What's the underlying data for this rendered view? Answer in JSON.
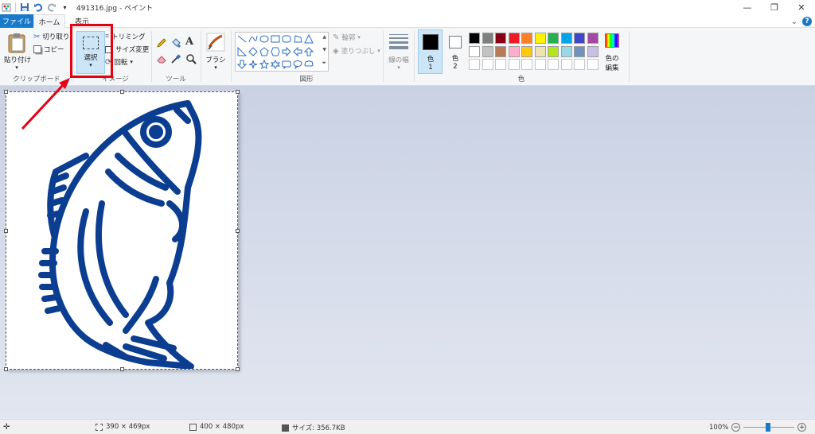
{
  "window": {
    "title": "491316.jpg - ペイント",
    "minimize": "—",
    "restore": "❐",
    "close": "✕"
  },
  "tabs": {
    "file": "ファイル",
    "home": "ホーム",
    "view": "表示"
  },
  "help": {
    "chevron": "⌄",
    "help": "?"
  },
  "clipboard": {
    "paste": "貼り付け",
    "cut": "切り取り",
    "copy": "コピー",
    "label": "クリップボード"
  },
  "image": {
    "select": "選択",
    "crop": "トリミング",
    "resize": "サイズ変更",
    "rotate": "回転",
    "label": "イメージ"
  },
  "tools": {
    "label": "ツール"
  },
  "brushes": {
    "label": "ブラシ"
  },
  "shapes": {
    "outline": "輪郭",
    "fill": "塗りつぶし",
    "label": "図形"
  },
  "size": {
    "label": "線の幅"
  },
  "colors": {
    "color1_label": "色",
    "color1_num": "1",
    "color2_label": "色",
    "color2_num": "2",
    "edit_line1": "色の",
    "edit_line2": "編集",
    "label": "色",
    "color1": "#000000",
    "color2": "#ffffff",
    "palette_row1": [
      "#000000",
      "#7f7f7f",
      "#880015",
      "#ed1c24",
      "#ff7f27",
      "#fff200",
      "#22b14c",
      "#00a2e8",
      "#3f48cc",
      "#a349a4"
    ],
    "palette_row2": [
      "#ffffff",
      "#c3c3c3",
      "#b97a57",
      "#ffaec9",
      "#ffc90e",
      "#efe4b0",
      "#b5e61d",
      "#99d9ea",
      "#7092be",
      "#c8bfe7"
    ]
  },
  "status": {
    "selection_size": "390 × 469px",
    "image_size": "400 × 480px",
    "file_size": "サイズ: 356.7KB",
    "zoom": "100%"
  },
  "canvas": {
    "drawing_color": "#0b3d91"
  }
}
